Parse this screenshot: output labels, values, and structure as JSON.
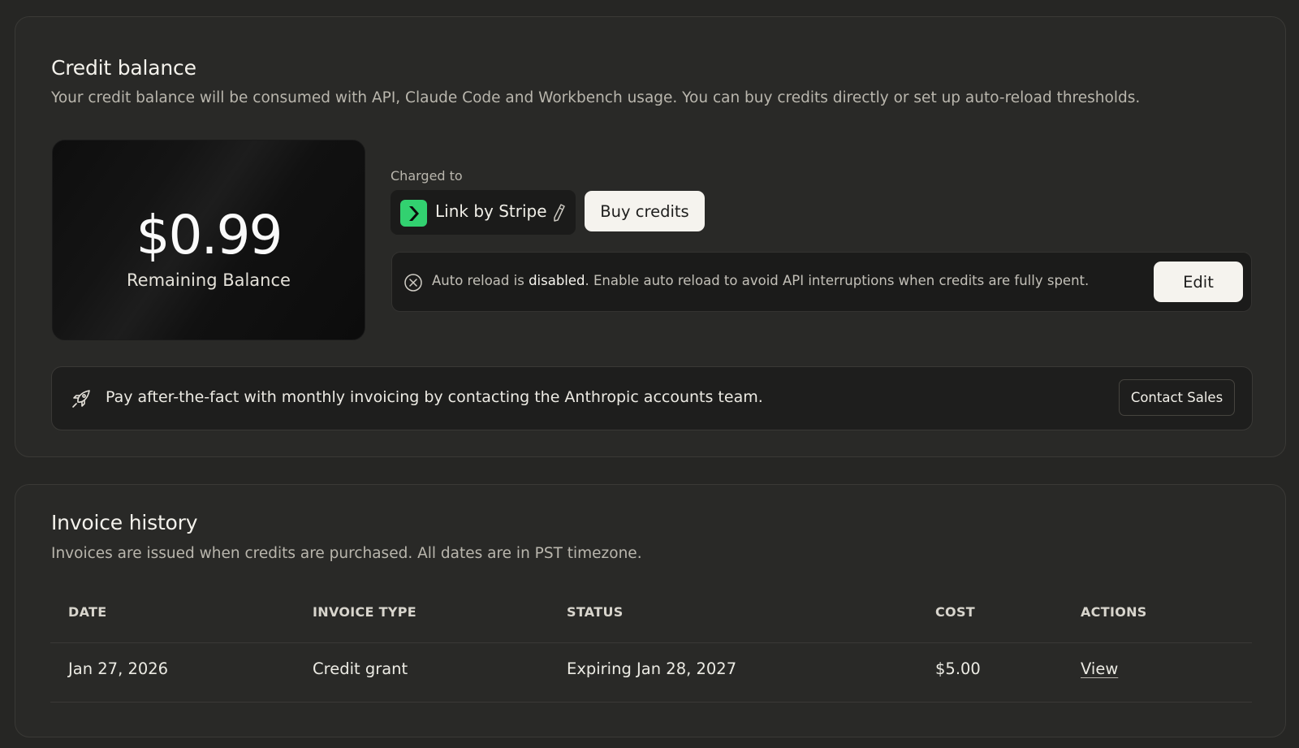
{
  "credit": {
    "title": "Credit balance",
    "description": "Your credit balance will be consumed with API, Claude Code and Workbench usage. You can buy credits directly or set up auto-reload thresholds.",
    "balance_amount": "$0.99",
    "balance_label": "Remaining Balance",
    "charged_to_label": "Charged to",
    "payment_method": "Link by Stripe",
    "buy_label": "Buy credits",
    "reload_prefix": "Auto reload is ",
    "reload_state": "disabled",
    "reload_suffix": ". Enable auto reload to avoid API interruptions when credits are fully spent.",
    "edit_label": "Edit",
    "banner_text": "Pay after-the-fact with monthly invoicing by contacting the Anthropic accounts team.",
    "contact_label": "Contact Sales",
    "accent_color": "#32d170"
  },
  "invoices": {
    "title": "Invoice history",
    "description": "Invoices are issued when credits are purchased. All dates are in PST timezone.",
    "columns": [
      "DATE",
      "INVOICE TYPE",
      "STATUS",
      "COST",
      "ACTIONS"
    ],
    "rows": [
      {
        "date": "Jan 27, 2026",
        "type": "Credit grant",
        "status": "Expiring Jan 28, 2027",
        "cost": "$5.00",
        "action": "View"
      }
    ]
  }
}
